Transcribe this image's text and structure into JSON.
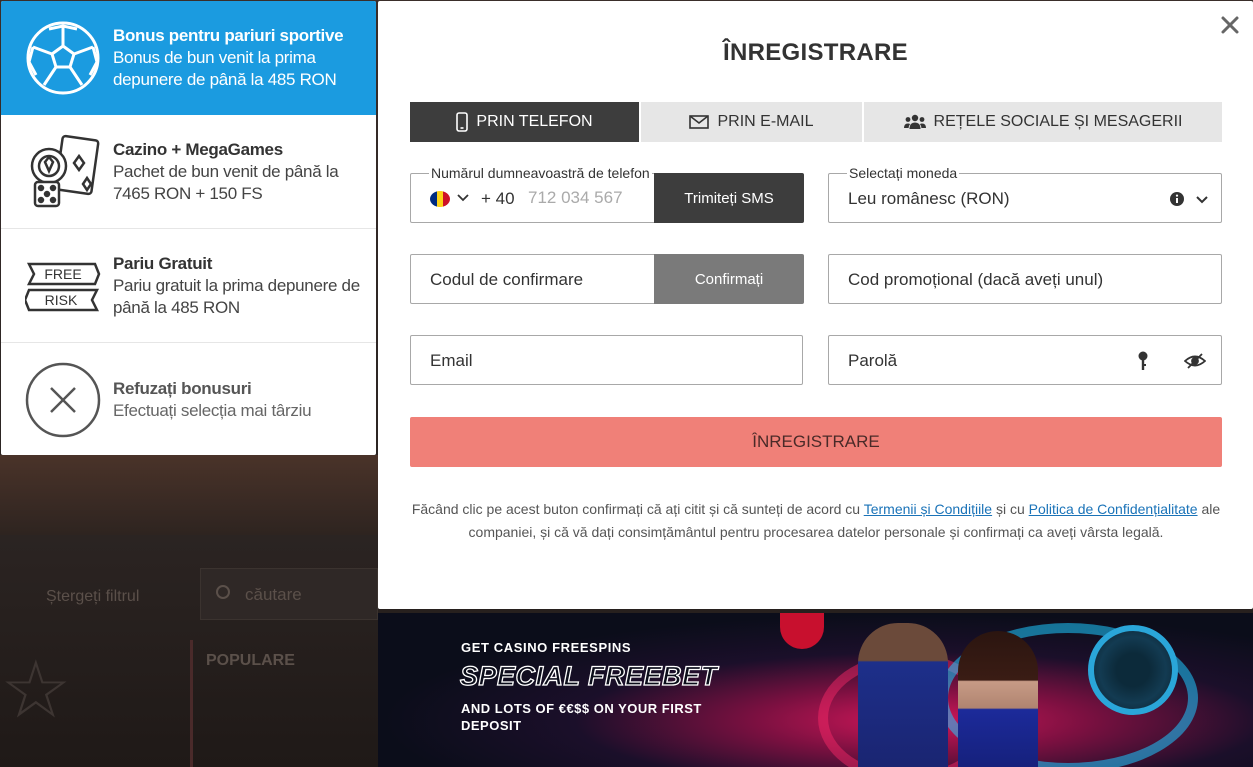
{
  "background": {
    "clear_label": "Ștergeți filtrul",
    "search_placeholder": "căutare",
    "section_label": "POPULARE"
  },
  "bonuses": [
    {
      "title": "Bonus pentru pariuri sportive",
      "desc": "Bonus de bun venit la prima depunere de până la 485 RON",
      "icon": "soccer-ball-icon",
      "active": true
    },
    {
      "title": "Cazino + MegaGames",
      "desc": "Pachet de bun venit de până la 7465 RON + 150 FS",
      "icon": "casino-chips-dice-icon",
      "active": false
    },
    {
      "title": "Pariu Gratuit",
      "desc": "Pariu gratuit la prima depunere de până la 485 RON",
      "icon": "free-risk-icon",
      "active": false
    },
    {
      "title": "Refuzați bonusuri",
      "desc": "Efectuați selecția mai târziu",
      "icon": "close-circle-icon",
      "active": false
    }
  ],
  "free_risk_icon": {
    "line1": "FREE",
    "line2": "RISK"
  },
  "modal": {
    "title": "ÎNREGISTRARE",
    "tabs": [
      {
        "label": "PRIN TELEFON",
        "icon": "phone-icon",
        "active": true
      },
      {
        "label": "PRIN E-MAIL",
        "icon": "envelope-icon",
        "active": false
      },
      {
        "label": "REȚELE SOCIALE ȘI MESAGERII",
        "icon": "users-icon",
        "active": false
      }
    ],
    "phone": {
      "label": "Numărul dumneavoastră de telefon",
      "prefix": "+ 40",
      "placeholder": "712 034 567",
      "sms_button": "Trimiteți SMS",
      "flag_colors": [
        "#002B7F",
        "#FCD116",
        "#CE1126"
      ]
    },
    "currency": {
      "label": "Selectați moneda",
      "value": "Leu românesc (RON)"
    },
    "confirmation": {
      "placeholder": "Codul de confirmare",
      "button": "Confirmați"
    },
    "promo": {
      "placeholder": "Cod promoțional (dacă aveți unul)"
    },
    "email": {
      "placeholder": "Email"
    },
    "password": {
      "placeholder": "Parolă"
    },
    "submit": "ÎNREGISTRARE",
    "terms": {
      "part1": "Făcând clic pe acest buton confirmați că ați citit și că sunteți de acord cu ",
      "link1": "Termenii și Condițiile",
      "part2": " și cu ",
      "link2": "Politica de Confidențialitate",
      "part3": " ale companiei, și că vă dați consimțământul pentru procesarea datelor personale și confirmați ca aveți vârsta legală."
    }
  },
  "banner": {
    "line1": "GET CASINO FREESPINS",
    "line2": "SPECIAL FREEBET",
    "line3": "AND LOTS OF €€$$ ON YOUR FIRST DEPOSIT"
  },
  "colors": {
    "accent_blue": "#1b9be0",
    "submit_salmon": "#f08078",
    "dark_button": "#3d3d3d",
    "link": "#1a73b8"
  }
}
